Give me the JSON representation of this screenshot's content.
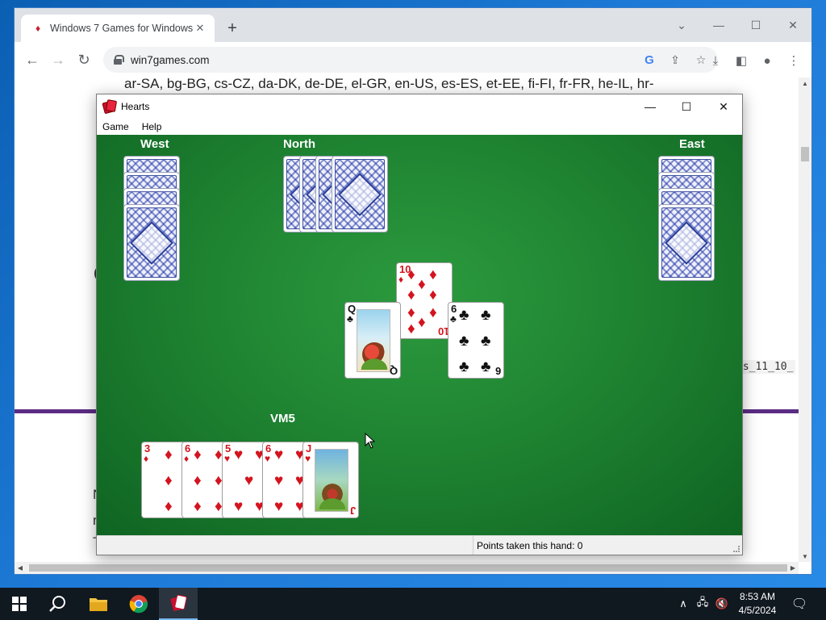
{
  "browser": {
    "tab_title": "Windows 7 Games for Windows 11 and 10",
    "url": "win7games.com",
    "new_tab_label": "+",
    "minimize": "—",
    "maximize": "☐",
    "close": "✕",
    "tabsearch": "⌄"
  },
  "page": {
    "lang_line": "ar-SA, bg-BG, cs-CZ, da-DK, de-DE, el-GR, en-US, es-ES, et-EE, fi-FI, fr-FR, he-IL, hr-",
    "fragment_left_1": "C",
    "fragment_code": "ws_11_10_",
    "fragment_left_2": "N",
    "fragment_left_3": "r",
    "fragment_left_4": "T"
  },
  "hearts": {
    "title": "Hearts",
    "menu": [
      "Game",
      "Help"
    ],
    "players": {
      "west": "West",
      "north": "North",
      "east": "East",
      "south": "VM5"
    },
    "status": "Points taken this hand: 0",
    "trick": [
      {
        "rank": "10",
        "suit": "♦",
        "color": "red"
      },
      {
        "rank": "Q",
        "suit": "♣",
        "color": "black"
      },
      {
        "rank": "6",
        "suit": "♣",
        "color": "black"
      }
    ],
    "hand": [
      {
        "rank": "3",
        "suit": "♦"
      },
      {
        "rank": "6",
        "suit": "♦"
      },
      {
        "rank": "5",
        "suit": "♥"
      },
      {
        "rank": "6",
        "suit": "♥"
      },
      {
        "rank": "J",
        "suit": "♥"
      }
    ]
  },
  "taskbar": {
    "time": "8:53 AM",
    "date": "4/5/2024"
  },
  "colors": {
    "felt": "#1f8432",
    "page_accent": "#5b2c83",
    "card_red": "#d4141e"
  }
}
